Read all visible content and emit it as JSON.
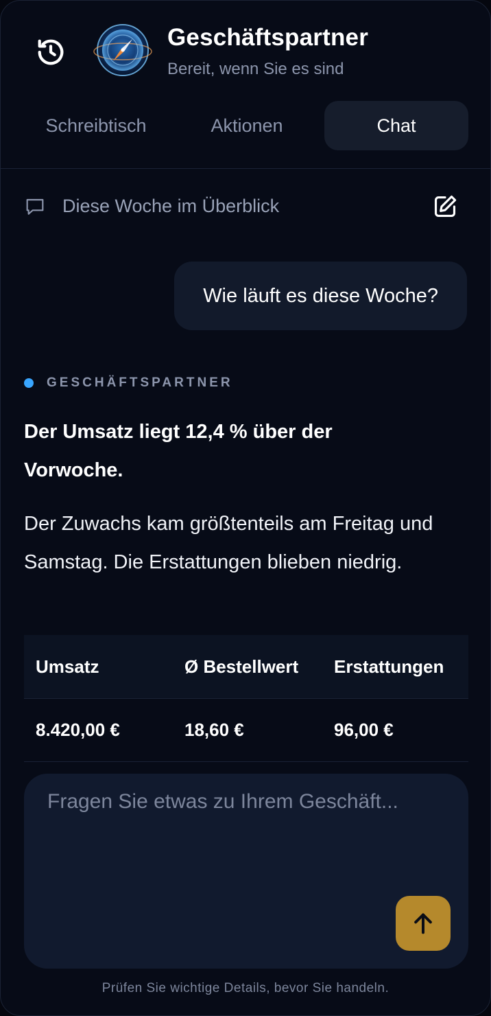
{
  "header": {
    "title": "Geschäftspartner",
    "subtitle": "Bereit, wenn Sie es sind",
    "history_icon": "history-icon",
    "avatar_icon": "compass-orb-icon"
  },
  "tabs": [
    {
      "label": "Schreibtisch",
      "active": false
    },
    {
      "label": "Aktionen",
      "active": false
    },
    {
      "label": "Chat",
      "active": true
    }
  ],
  "thread": {
    "title": "Diese Woche im Überblick",
    "thread_icon": "chat-bubble-icon",
    "edit_icon": "edit-icon"
  },
  "messages": {
    "user": "Wie läuft es diese Woche?",
    "assistant_name": "GESCHÄFTSPARTNER",
    "headline": "Der Umsatz liegt 12,4 % über der Vorwoche.",
    "body": "Der Zuwachs kam größtenteils am Freitag und Samstag. Die Erstattungen blieben niedrig."
  },
  "metrics": {
    "headers": [
      "Umsatz",
      "Ø Bestellwert",
      "Erstattungen"
    ],
    "values": [
      "8.420,00 €",
      "18,60 €",
      "96,00 €"
    ]
  },
  "composer": {
    "placeholder": "Fragen Sie etwas zu Ihrem Geschäft...",
    "value": "",
    "send_icon": "arrow-up-icon"
  },
  "footer": {
    "note": "Prüfen Sie wichtige Details, bevor Sie handeln."
  },
  "colors": {
    "background": "#070b17",
    "accent": "#b5892c",
    "assistant_dot": "#39a6ff",
    "active_tab": "#161d2c"
  }
}
